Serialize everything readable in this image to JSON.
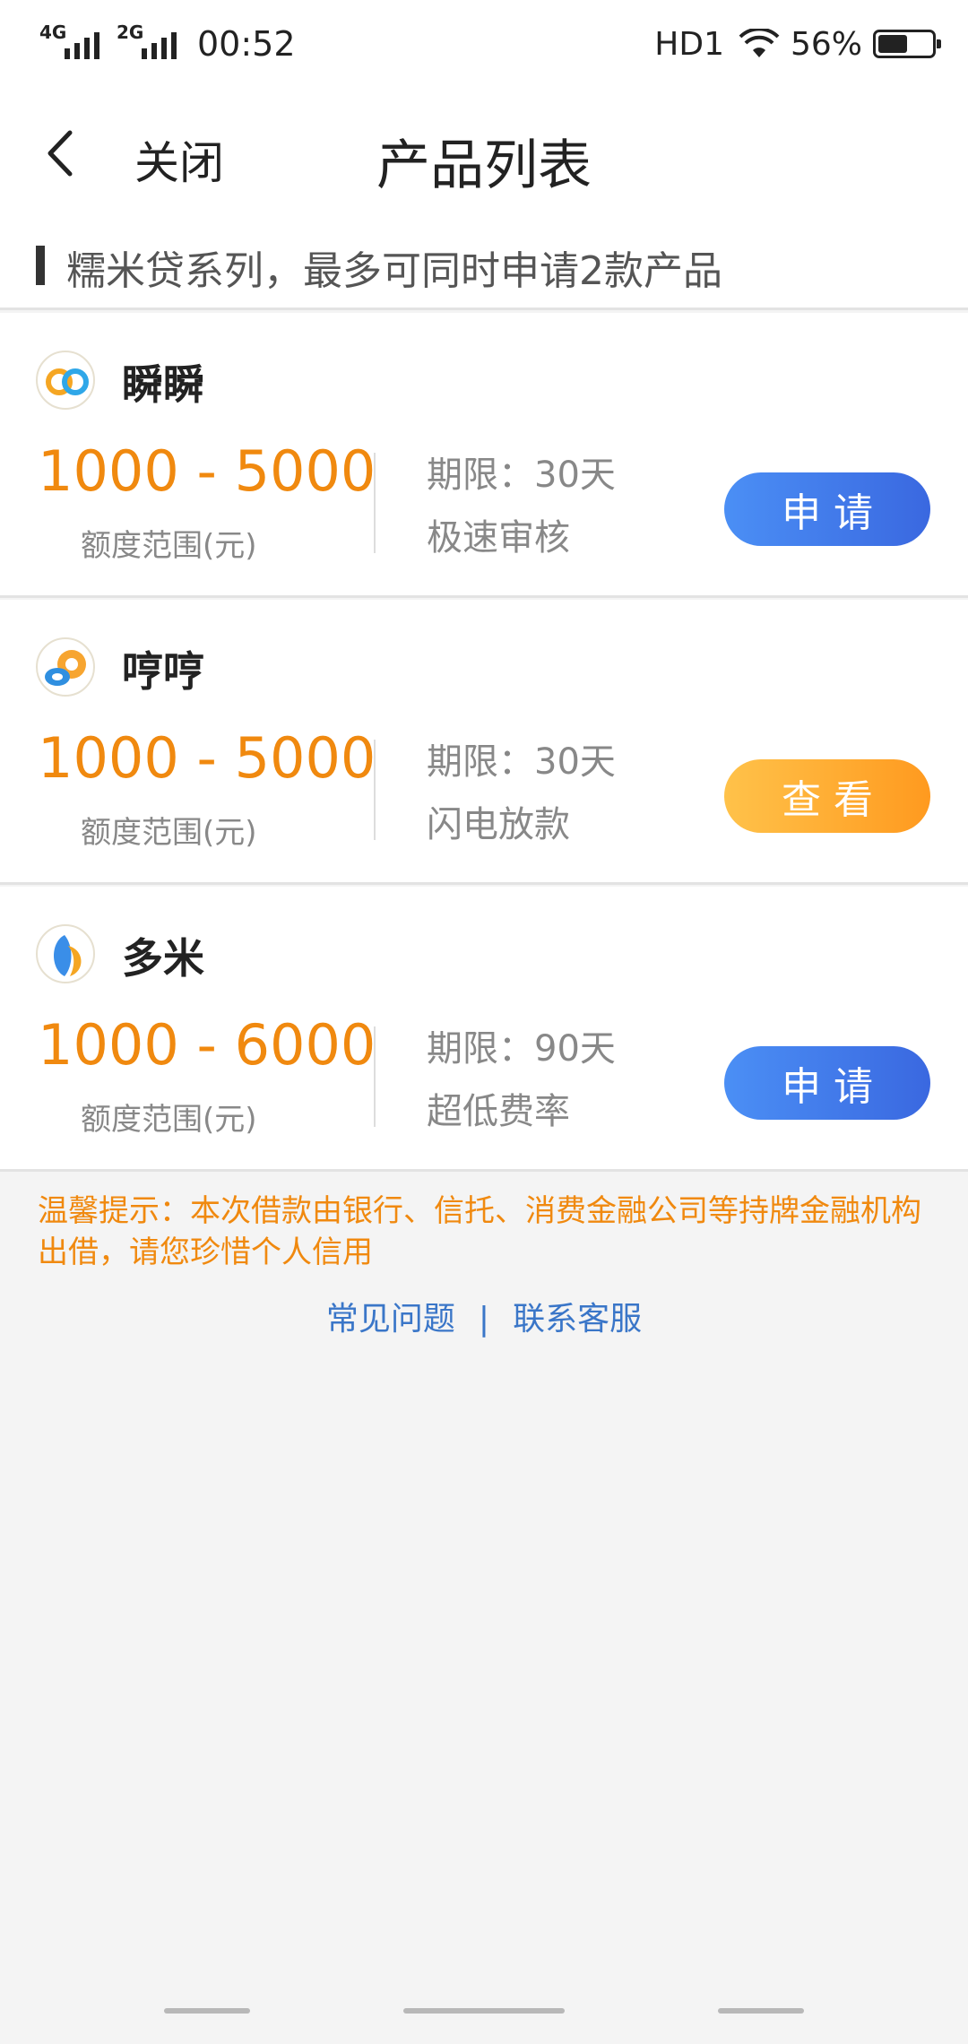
{
  "status_bar": {
    "network1": "4G",
    "network2": "2G",
    "time": "00:52",
    "hd": "HD1",
    "battery_text": "56%",
    "battery_level": 0.56
  },
  "nav": {
    "close_label": "关闭",
    "title": "产品列表"
  },
  "series": {
    "title": "糯米贷系列，最多可同时申请2款产品"
  },
  "products": [
    {
      "name": "瞬瞬",
      "range": "1000 - 5000",
      "range_label": "额度范围(元)",
      "term": "期限：30天",
      "feature": "极速审核",
      "button": "申请",
      "button_color": "#4b8ff5"
    },
    {
      "name": "哼哼",
      "range": "1000 - 5000",
      "range_label": "额度范围(元)",
      "term": "期限：30天",
      "feature": "闪电放款",
      "button": "查看",
      "button_color": "#ffa62a"
    },
    {
      "name": "多米",
      "range": "1000 - 6000",
      "range_label": "额度范围(元)",
      "term": "期限：90天",
      "feature": "超低费率",
      "button": "申请",
      "button_color": "#4b8ff5"
    }
  ],
  "notice": "温馨提示：本次借款由银行、信托、消费金融公司等持牌金融机构出借，请您珍惜个人信用",
  "links": {
    "faq": "常见问题",
    "separator": "|",
    "contact": "联系客服"
  },
  "colors": {
    "accent_orange": "#f0890f",
    "link_blue": "#3a76c8"
  }
}
